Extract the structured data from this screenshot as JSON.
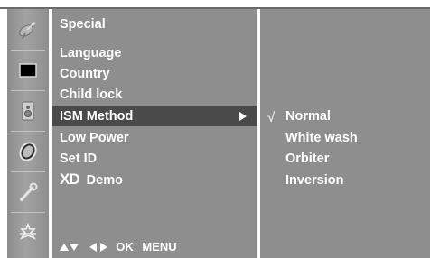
{
  "menu": {
    "title": "Special",
    "items": [
      {
        "label": "Language"
      },
      {
        "label": "Country"
      },
      {
        "label": "Child lock"
      },
      {
        "label": "ISM Method",
        "selected": true
      },
      {
        "label": "Low Power"
      },
      {
        "label": "Set ID"
      },
      {
        "label": "Demo",
        "logo": "XD"
      }
    ],
    "footer": {
      "nav": "OK",
      "menu": "MENU"
    }
  },
  "submenu": {
    "check_mark": "√",
    "options": [
      {
        "label": "Normal",
        "checked": true
      },
      {
        "label": "White wash"
      },
      {
        "label": "Orbiter"
      },
      {
        "label": "Inversion"
      }
    ]
  },
  "icons": [
    "satellite-dish-icon",
    "picture-icon",
    "speaker-icon",
    "clock-icon",
    "wrench-icon",
    "special-icon"
  ],
  "colors": {
    "panel": "#8e8e8e",
    "highlight": "#4a4a4a",
    "text": "#ffffff"
  }
}
